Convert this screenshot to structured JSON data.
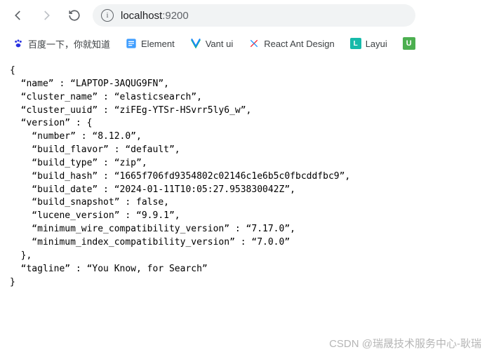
{
  "browser": {
    "url_host": "localhost",
    "url_port": ":9200"
  },
  "bookmarks": {
    "baidu": "百度一下，你就知道",
    "element": "Element",
    "vant": "Vant ui",
    "react": "React Ant Design",
    "layui": "Layui"
  },
  "json_response": {
    "name": "LAPTOP-3AQUG9FN",
    "cluster_name": "elasticsearch",
    "cluster_uuid": "ziFEg-YTSr-HSvrr5ly6_w",
    "version": {
      "number": "8.12.0",
      "build_flavor": "default",
      "build_type": "zip",
      "build_hash": "1665f706fd9354802c02146c1e6b5c0fbcddfbc9",
      "build_date": "2024-01-11T10:05:27.953830042Z",
      "build_snapshot": "false",
      "lucene_version": "9.9.1",
      "minimum_wire_compatibility_version": "7.17.0",
      "minimum_index_compatibility_version": "7.0.0"
    },
    "tagline": "You Know, for Search"
  },
  "watermark": "CSDN @瑞晟技术服务中心-耿瑞"
}
